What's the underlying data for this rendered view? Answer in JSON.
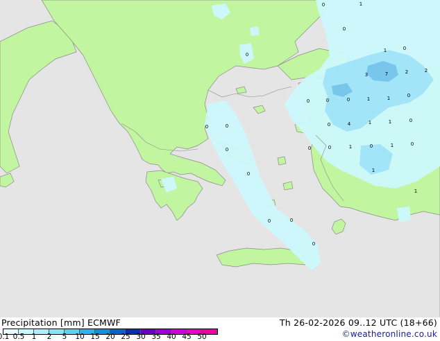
{
  "title": {
    "left": "Precipitation [mm]  ECMWF",
    "right": "Th 26-02-2026 09..12 UTC (18+66)",
    "credit": "©weatheronline.co.uk"
  },
  "legend": {
    "labels": [
      "0.1",
      "0.5",
      "1",
      "2",
      "5",
      "10",
      "15",
      "20",
      "25",
      "30",
      "35",
      "40",
      "45",
      "50"
    ],
    "colors": [
      "#e6fcff",
      "#c8f8ff",
      "#a8f0fc",
      "#86e4f8",
      "#5ed0f2",
      "#32b2ea",
      "#168fdc",
      "#0a64c8",
      "#0a2ea8",
      "#6a00c8",
      "#a000d8",
      "#d000d8",
      "#e800c8",
      "#f000a0"
    ]
  },
  "map": {
    "colors": {
      "sea": "#e5e5e5",
      "land": "#c2f5a0",
      "rain_light": "#ccf8fc",
      "rain_mid": "#a2e4f8",
      "rain_heavy": "#78c6ec",
      "coast": "#8a8a8a"
    },
    "values": [
      "1",
      "0",
      "0",
      "1",
      "0",
      "3",
      "7",
      "2",
      "2",
      "0",
      "0",
      "0",
      "0",
      "1",
      "1",
      "0",
      "0",
      "4",
      "1",
      "1",
      "0",
      "0",
      "0",
      "0",
      "1",
      "0",
      "1",
      "0",
      "0",
      "1",
      "1",
      "0",
      "0",
      "0",
      "0",
      "0"
    ]
  }
}
